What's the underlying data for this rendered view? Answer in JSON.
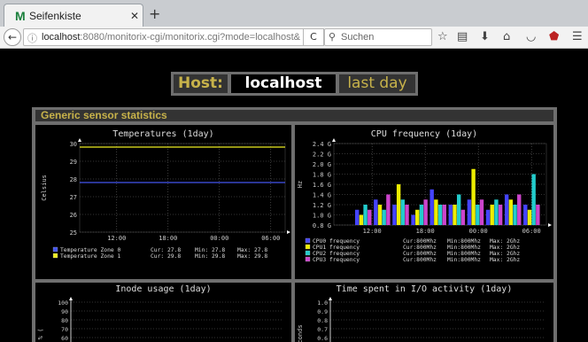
{
  "browser": {
    "tab_title": "Seifenkiste",
    "tab_logo": "M",
    "url_prefix": "localhost",
    "url_rest": ":8080/monitorix-cgi/monitorix.cgi?mode=localhost&",
    "search_placeholder": "Suchen",
    "icons": [
      "star-icon",
      "reading-list-icon",
      "download-icon",
      "home-icon",
      "pocket-icon",
      "ublock-icon",
      "menu-icon"
    ]
  },
  "header": {
    "host_label": "Host:",
    "host_value": "localhost",
    "period": "last day"
  },
  "section": {
    "title": "Generic sensor statistics"
  },
  "colors": {
    "label_gold": "#c7b24a",
    "frame_grey": "#6e6e6e",
    "series_blue": "#4455ee",
    "series_yellow": "#eeee22",
    "cpu0": "#4444ff",
    "cpu1": "#eeee00",
    "cpu2": "#22cccc",
    "cpu3": "#cc44cc"
  },
  "charts": {
    "temperatures": {
      "title": "Temperatures  (1day)",
      "ylabel": "Celsius",
      "y_ticks": [
        "30",
        "29",
        "28",
        "27",
        "26",
        "25"
      ],
      "x_ticks": [
        "12:00",
        "18:00",
        "00:00",
        "06:00"
      ],
      "legend": [
        {
          "name": "Temperature Zone 0",
          "cur": "Cur: 27.8",
          "min": "Min: 27.8",
          "max": "Max: 27.8"
        },
        {
          "name": "Temperature Zone 1",
          "cur": "Cur: 29.8",
          "min": "Min: 29.8",
          "max": "Max: 29.8"
        }
      ]
    },
    "cpu": {
      "title": "CPU frequency  (1day)",
      "ylabel": "Hz",
      "y_ticks": [
        "2.4 G",
        "2.2 G",
        "2.0 G",
        "1.8 G",
        "1.6 G",
        "1.4 G",
        "1.2 G",
        "1.0 G",
        "0.8 G"
      ],
      "x_ticks": [
        "12:00",
        "18:00",
        "00:00",
        "06:00"
      ],
      "legend": [
        {
          "name": "CPU0 frequency",
          "cur": "Cur:800Mhz",
          "min": "Min:800Mhz",
          "max": "Max:  2Ghz"
        },
        {
          "name": "CPU1 frequency",
          "cur": "Cur:800Mhz",
          "min": "Min:800Mhz",
          "max": "Max:  2Ghz"
        },
        {
          "name": "CPU2 frequency",
          "cur": "Cur:800Mhz",
          "min": "Min:800Mhz",
          "max": "Max:  2Ghz"
        },
        {
          "name": "CPU3 frequency",
          "cur": "Cur:800Mhz",
          "min": "Min:800Mhz",
          "max": "Max:  2Ghz"
        }
      ]
    },
    "inode": {
      "title": "Inode usage  (1day)",
      "ylabel": "% (",
      "y_ticks": [
        "100",
        "90",
        "80",
        "70",
        "60"
      ]
    },
    "io": {
      "title": "Time spent in I/O activity  (1day)",
      "ylabel": "conds",
      "y_ticks": [
        "1.0",
        "0.9",
        "0.8",
        "0.7",
        "0.6"
      ]
    }
  },
  "chart_data": [
    {
      "type": "line",
      "title": "Temperatures  (1day)",
      "ylabel": "Celsius",
      "x": [
        "12:00",
        "18:00",
        "00:00",
        "06:00"
      ],
      "ylim": [
        25,
        30
      ],
      "series": [
        {
          "name": "Temperature Zone 0",
          "values": [
            27.8,
            27.8,
            27.8,
            27.8
          ]
        },
        {
          "name": "Temperature Zone 1",
          "values": [
            29.8,
            29.8,
            29.8,
            29.8
          ]
        }
      ]
    },
    {
      "type": "bar",
      "title": "CPU frequency  (1day)",
      "ylabel": "Hz",
      "ylim": [
        0.8,
        2.4
      ],
      "x": [
        "12:00",
        "18:00",
        "00:00",
        "06:00"
      ],
      "series": [
        {
          "name": "CPU0 frequency",
          "values": [
            1.1,
            1.3,
            1.2,
            1.0,
            1.5,
            1.2,
            1.3,
            1.1,
            1.4,
            1.2
          ]
        },
        {
          "name": "CPU1 frequency",
          "values": [
            1.0,
            1.2,
            1.6,
            1.1,
            1.3,
            1.2,
            1.9,
            1.2,
            1.3,
            1.1
          ]
        },
        {
          "name": "CPU2 frequency",
          "values": [
            1.2,
            1.1,
            1.3,
            1.2,
            1.2,
            1.4,
            1.2,
            1.3,
            1.2,
            1.8
          ]
        },
        {
          "name": "CPU3 frequency",
          "values": [
            1.1,
            1.4,
            1.2,
            1.3,
            1.2,
            1.1,
            1.3,
            1.2,
            1.4,
            1.2
          ]
        }
      ]
    }
  ]
}
